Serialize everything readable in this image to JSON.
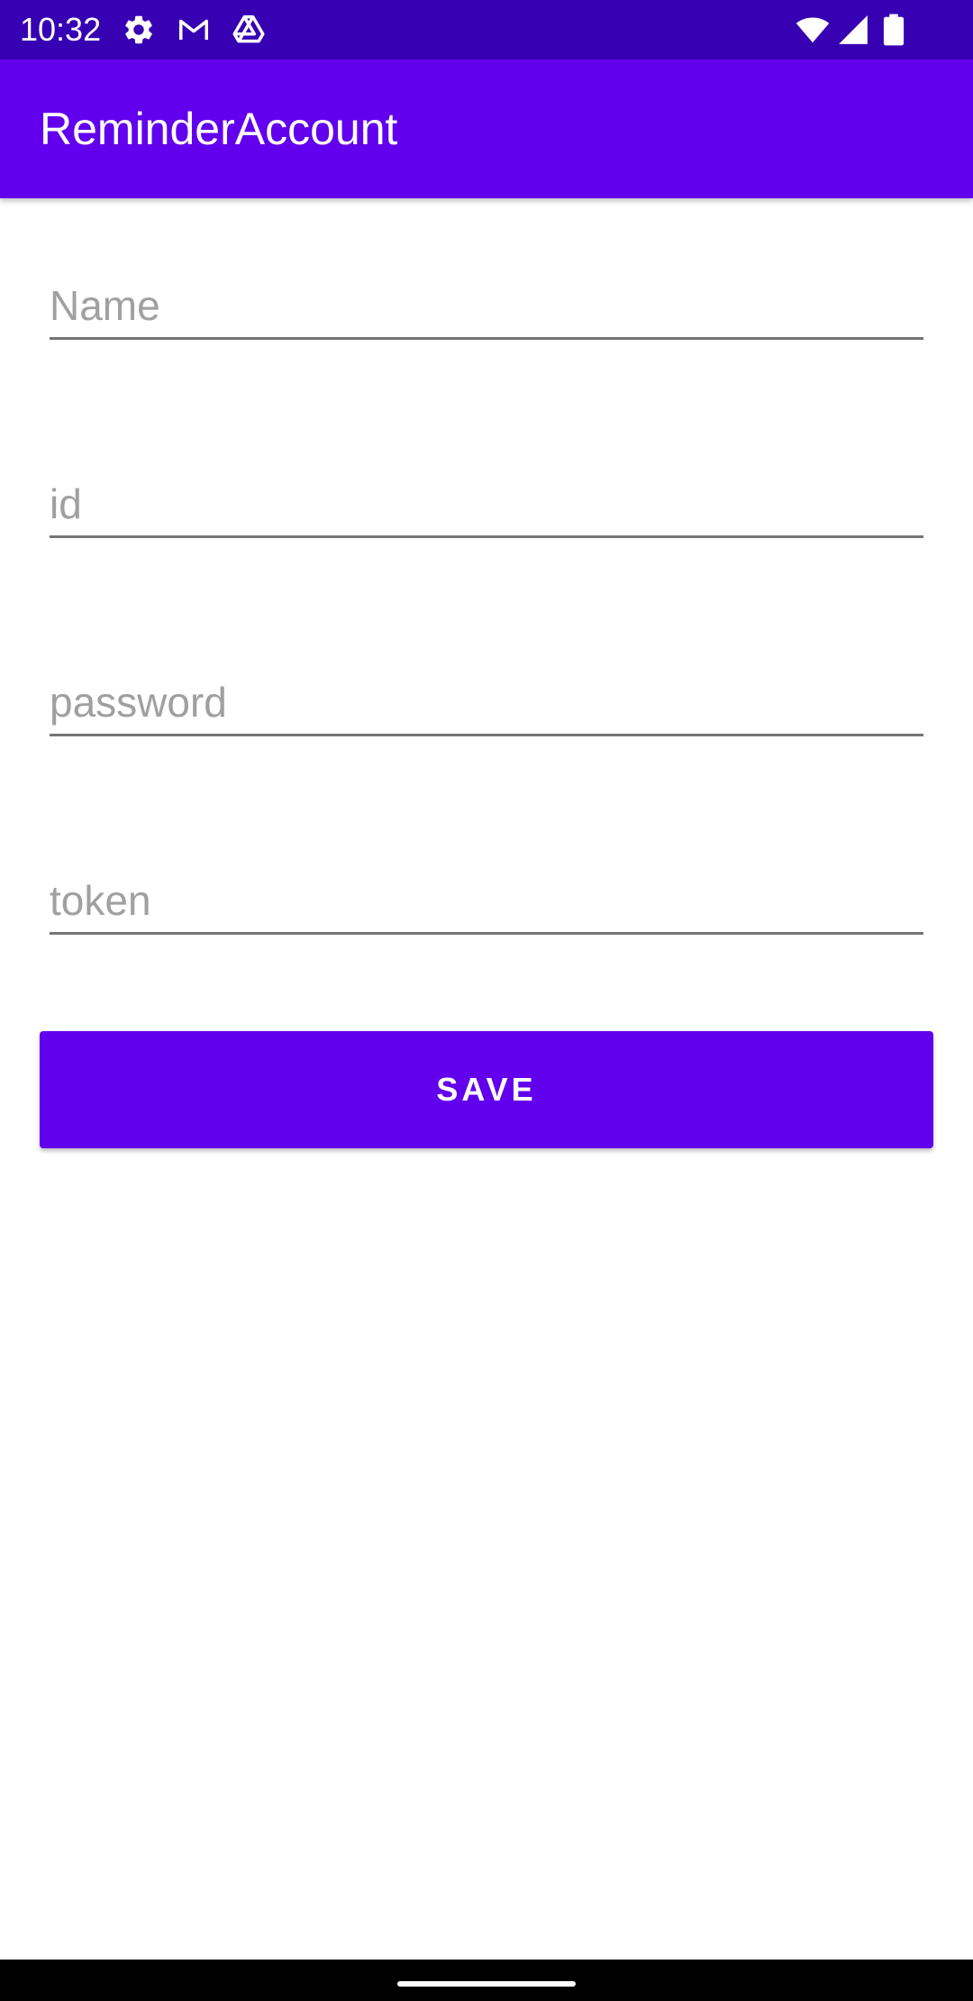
{
  "status_bar": {
    "time": "10:32",
    "left_icons": [
      "gear-icon",
      "gmail-icon",
      "drive-icon"
    ],
    "right_icons": [
      "wifi-icon",
      "signal-icon",
      "battery-icon"
    ],
    "background_color": "#3700B3"
  },
  "app_bar": {
    "title": "ReminderAccount",
    "background_color": "#6200EE"
  },
  "form": {
    "fields": [
      {
        "placeholder": "Name",
        "value": ""
      },
      {
        "placeholder": "id",
        "value": ""
      },
      {
        "placeholder": "password",
        "value": ""
      },
      {
        "placeholder": "token",
        "value": ""
      }
    ],
    "save_label": "SAVE"
  },
  "colors": {
    "accent": "#6200EE",
    "status_bar": "#3700B3",
    "hint_text": "#A0A0A0",
    "underline": "#757575"
  }
}
